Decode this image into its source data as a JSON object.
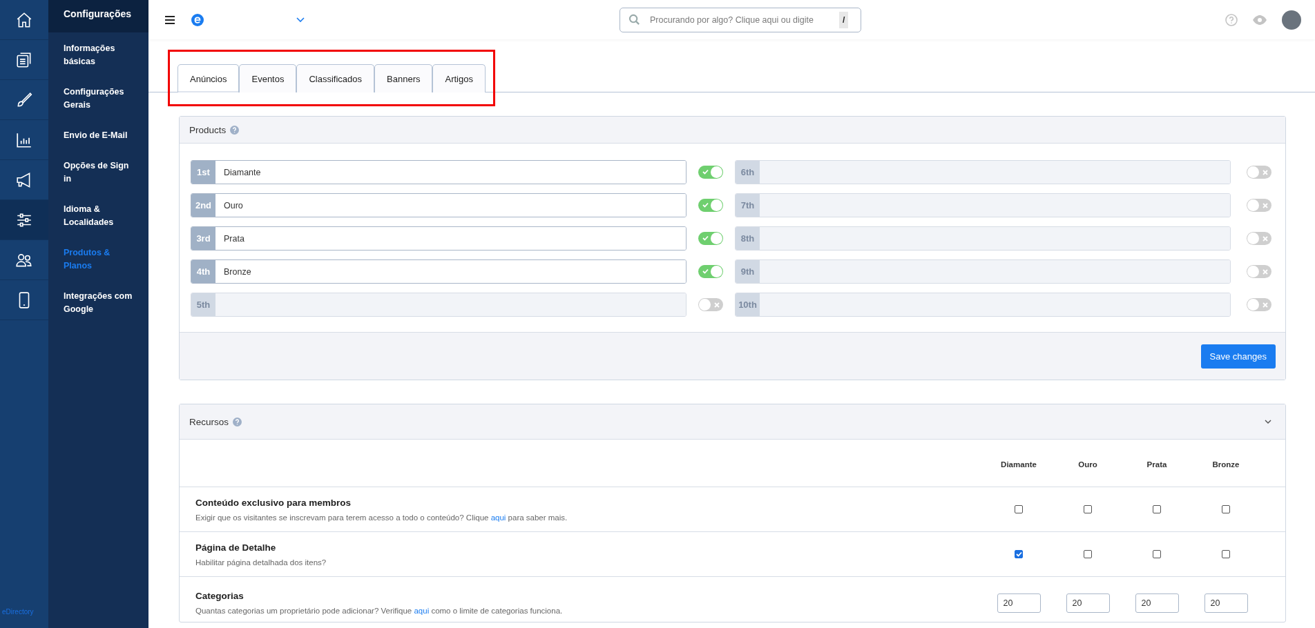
{
  "icon_rail": {
    "items": [
      {
        "kind": "home",
        "selected": false
      },
      {
        "kind": "pages",
        "selected": false
      },
      {
        "kind": "brush",
        "selected": false
      },
      {
        "kind": "chart",
        "selected": false
      },
      {
        "kind": "megaphone",
        "selected": false
      },
      {
        "kind": "sliders",
        "selected": true
      },
      {
        "kind": "users",
        "selected": false
      },
      {
        "kind": "phone",
        "selected": false
      }
    ],
    "brand": "eDirectory"
  },
  "sidebar": {
    "title": "Configurações",
    "items": [
      {
        "label": "Informações básicas",
        "selected": false
      },
      {
        "label": "Configurações Gerais",
        "selected": false
      },
      {
        "label": "Envio de E-Mail",
        "selected": false
      },
      {
        "label": "Opções de Sign in",
        "selected": false
      },
      {
        "label": "Idioma & Localidades",
        "selected": false
      },
      {
        "label": "Produtos & Planos",
        "selected": true
      },
      {
        "label": "Integrações com Google",
        "selected": false
      }
    ]
  },
  "header": {
    "search": {
      "placeholder": "Procurando por algo? Clique aqui ou digite",
      "shortcut": "/"
    }
  },
  "tabs": [
    {
      "label": "Anúncios",
      "selected": true
    },
    {
      "label": "Eventos",
      "selected": false
    },
    {
      "label": "Classificados",
      "selected": false
    },
    {
      "label": "Banners",
      "selected": false
    },
    {
      "label": "Artigos",
      "selected": false
    }
  ],
  "products": {
    "title": "Products",
    "rows": [
      {
        "rank": "1st",
        "value": "Diamante",
        "enabled": true
      },
      {
        "rank": "2nd",
        "value": "Ouro",
        "enabled": true
      },
      {
        "rank": "3rd",
        "value": "Prata",
        "enabled": true
      },
      {
        "rank": "4th",
        "value": "Bronze",
        "enabled": true
      },
      {
        "rank": "5th",
        "value": "",
        "enabled": false
      },
      {
        "rank": "6th",
        "value": "",
        "enabled": false
      },
      {
        "rank": "7th",
        "value": "",
        "enabled": false
      },
      {
        "rank": "8th",
        "value": "",
        "enabled": false
      },
      {
        "rank": "9th",
        "value": "",
        "enabled": false
      },
      {
        "rank": "10th",
        "value": "",
        "enabled": false
      }
    ],
    "save_button": "Save changes"
  },
  "resources": {
    "title": "Recursos",
    "columns": [
      "Diamante",
      "Ouro",
      "Prata",
      "Bronze"
    ],
    "rows": [
      {
        "kind": "checkbox",
        "title": "Conteúdo exclusivo para membros",
        "description_before": "Exigir que os visitantes se inscrevam para terem acesso a todo o conteúdo? Clique",
        "link": "aqui",
        "description_after": "para saber mais.",
        "cells": [
          {
            "checked": false
          },
          {
            "checked": false
          },
          {
            "checked": false
          },
          {
            "checked": false
          }
        ]
      },
      {
        "kind": "checkbox",
        "title": "Página de Detalhe",
        "description_before": "Habilitar página detalhada dos itens?",
        "cells": [
          {
            "checked": true
          },
          {
            "checked": false
          },
          {
            "checked": false
          },
          {
            "checked": false
          }
        ]
      },
      {
        "kind": "number",
        "title": "Categorias",
        "description_before": "Quantas categorias um proprietário pode adicionar? Verifique",
        "link": "aqui",
        "description_after": "como o limite de categorias funciona.",
        "cells": [
          {
            "value": "20"
          },
          {
            "value": "20"
          },
          {
            "value": "20"
          },
          {
            "value": "20"
          }
        ]
      }
    ]
  }
}
